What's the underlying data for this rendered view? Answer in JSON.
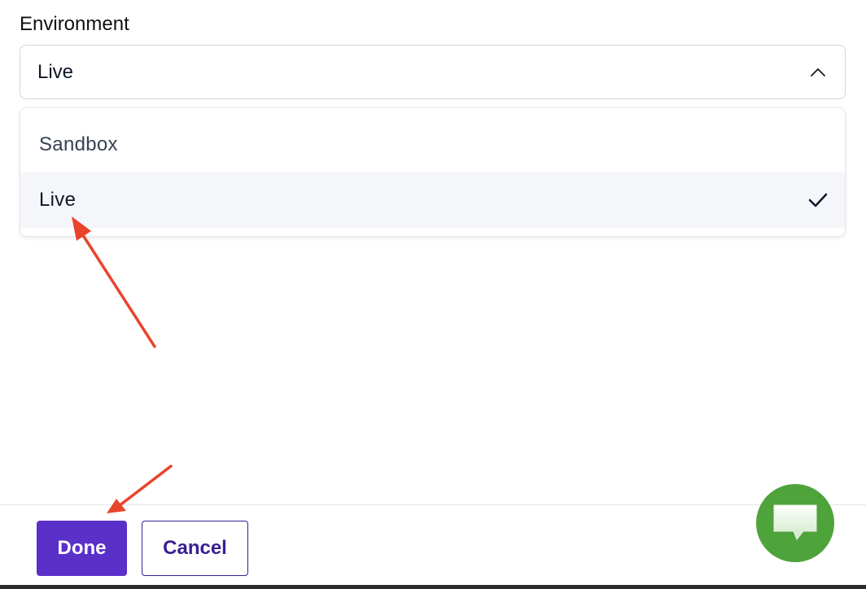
{
  "environment": {
    "label": "Environment",
    "selected_value": "Live",
    "options": [
      {
        "label": "Sandbox",
        "selected": false
      },
      {
        "label": "Live",
        "selected": true
      }
    ]
  },
  "footer": {
    "done_label": "Done",
    "cancel_label": "Cancel"
  },
  "icons": {
    "select_indicator": "chevron-up-icon",
    "selected_indicator": "checkmark-icon",
    "chat": "chat-bubble-icon"
  },
  "colors": {
    "primary": "#5b30c9",
    "cancel_text": "#3b1e93",
    "chat": "#4ea33a",
    "annotation": "#e8442c",
    "selected_row_bg": "#f5f6fa"
  }
}
